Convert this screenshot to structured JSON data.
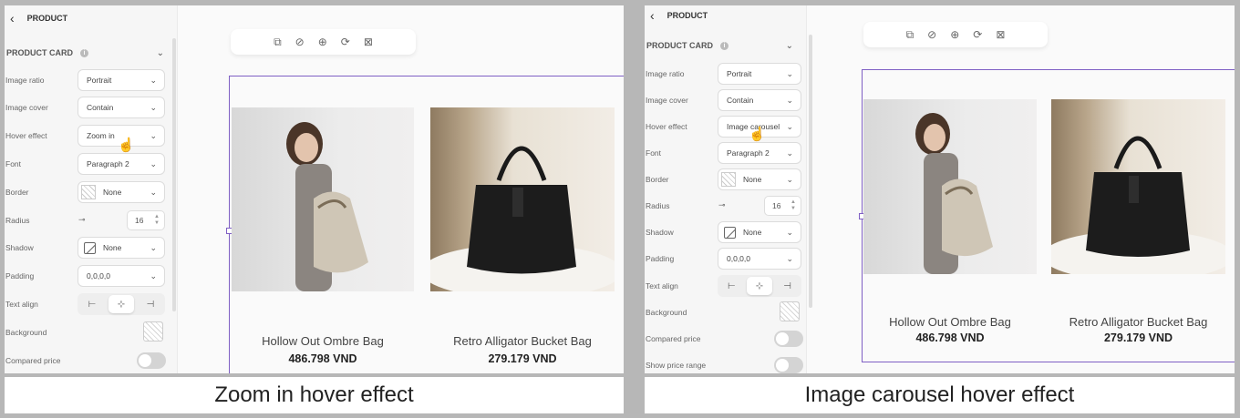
{
  "panels": [
    {
      "header": "PRODUCT",
      "section": "PRODUCT CARD",
      "rows": {
        "image_ratio": {
          "label": "Image ratio",
          "value": "Portrait"
        },
        "image_cover": {
          "label": "Image cover",
          "value": "Contain"
        },
        "hover_effect": {
          "label": "Hover effect",
          "value": "Zoom in"
        },
        "font": {
          "label": "Font",
          "value": "Paragraph 2"
        },
        "border": {
          "label": "Border",
          "value": "None"
        },
        "radius": {
          "label": "Radius",
          "value": "16"
        },
        "shadow": {
          "label": "Shadow",
          "value": "None"
        },
        "padding": {
          "label": "Padding",
          "value": "0,0,0,0"
        },
        "text_align": {
          "label": "Text align"
        },
        "background": {
          "label": "Background"
        },
        "compared_price": {
          "label": "Compared price"
        }
      },
      "products": [
        {
          "name": "Hollow Out Ombre Bag",
          "price": "486.798 VND"
        },
        {
          "name": "Retro Alligator Bucket Bag",
          "price": "279.179 VND"
        }
      ],
      "caption": "Zoom in hover effect"
    },
    {
      "header": "PRODUCT",
      "section": "PRODUCT CARD",
      "rows": {
        "image_ratio": {
          "label": "Image ratio",
          "value": "Portrait"
        },
        "image_cover": {
          "label": "Image cover",
          "value": "Contain"
        },
        "hover_effect": {
          "label": "Hover effect",
          "value": "Image carousel"
        },
        "font": {
          "label": "Font",
          "value": "Paragraph 2"
        },
        "border": {
          "label": "Border",
          "value": "None"
        },
        "radius": {
          "label": "Radius",
          "value": "16"
        },
        "shadow": {
          "label": "Shadow",
          "value": "None"
        },
        "padding": {
          "label": "Padding",
          "value": "0,0,0,0"
        },
        "text_align": {
          "label": "Text align"
        },
        "background": {
          "label": "Background"
        },
        "compared_price": {
          "label": "Compared price"
        },
        "show_price_range": {
          "label": "Show price range"
        }
      },
      "products": [
        {
          "name": "Hollow Out Ombre Bag",
          "price": "486.798 VND"
        },
        {
          "name": "Retro Alligator Bucket Bag",
          "price": "279.179 VND"
        }
      ],
      "caption": "Image carousel hover effect"
    }
  ],
  "colors": {
    "selection": "#7f5fc4",
    "background": "#b7b7b7",
    "canvas": "#fafafa"
  },
  "icons": [
    "back-chevron-icon",
    "info-icon",
    "chevron-down-icon",
    "duplicate-icon",
    "hide-icon",
    "add-section-icon",
    "swap-icon",
    "delete-icon",
    "hand-cursor-icon",
    "align-left-icon",
    "align-center-icon",
    "align-right-icon"
  ]
}
